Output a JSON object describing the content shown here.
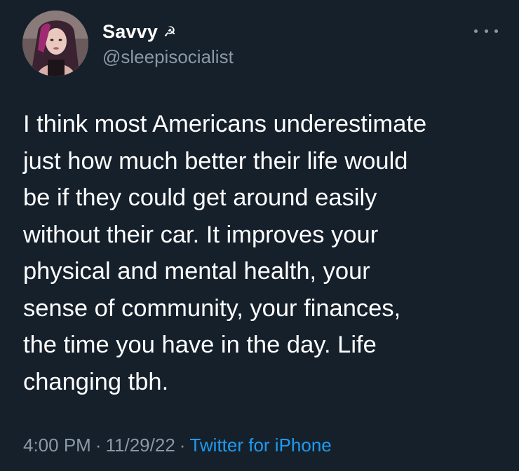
{
  "author": {
    "display_name": "Savvy",
    "emoji": "☭",
    "handle": "@sleepisocialist"
  },
  "tweet": {
    "text": "I think most Americans underestimate\njust how much better their life would\nbe if they could get around easily\nwithout their car. It improves your\nphysical and mental health, your\nsense of community, your finances,\nthe time you have in the day. Life\nchanging tbh.",
    "time": "4:00 PM",
    "separator": "·",
    "date": "11/29/22",
    "source": "Twitter for iPhone"
  },
  "icons": {
    "more": "more-options-icon",
    "avatar": "avatar"
  },
  "colors": {
    "background": "#15202b",
    "primary_text": "#ffffff",
    "secondary_text": "#8b98a5",
    "link": "#1d9bf0"
  }
}
